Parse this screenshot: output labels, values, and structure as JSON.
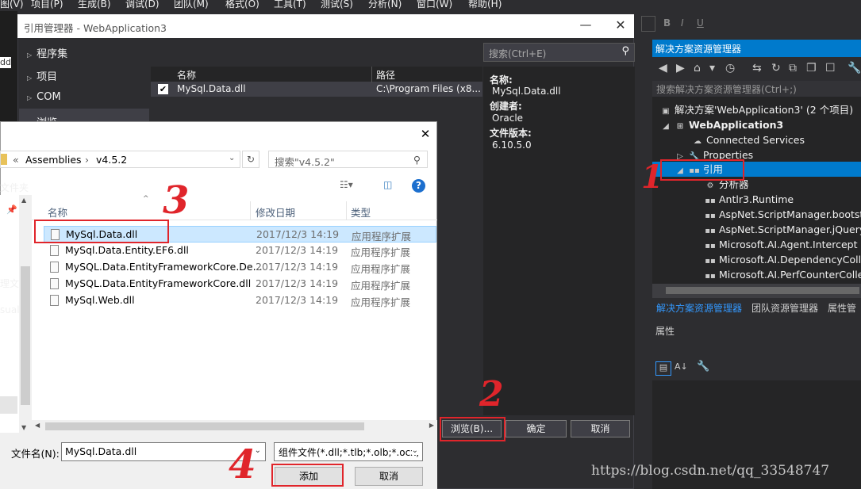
{
  "menu": [
    "图(V)",
    "项目(P)",
    "生成(B)",
    "调试(D)",
    "团队(M)",
    "格式(O)",
    "工具(T)",
    "测试(S)",
    "分析(N)",
    "窗口(W)",
    "帮助(H)"
  ],
  "left_edge_fragments": [
    "ddl",
    "理文",
    "sual"
  ],
  "reference_manager": {
    "title": "引用管理器 - WebApplication3",
    "nav": [
      "程序集",
      "项目",
      "COM",
      "浏览"
    ],
    "search_placeholder": "搜索(Ctrl+E)",
    "list_headers": {
      "name": "名称",
      "path": "路径"
    },
    "row": {
      "checked": true,
      "name": "MySql.Data.dll",
      "path": "C:\\Program Files (x8..."
    },
    "details": {
      "name_label": "名称:",
      "name_value": "MySql.Data.dll",
      "creator_label": "创建者:",
      "creator_value": "Oracle",
      "version_label": "文件版本:",
      "version_value": "6.10.5.0"
    },
    "buttons": {
      "browse": "浏览(B)...",
      "ok": "确定",
      "cancel": "取消"
    }
  },
  "file_dialog": {
    "breadcrumb": [
      "Assemblies",
      "v4.5.2"
    ],
    "search_placeholder": "搜索\"v4.5.2\"",
    "nav_fragment": "文件夹",
    "columns": {
      "name": "名称",
      "date": "修改日期",
      "type": "类型"
    },
    "files": [
      {
        "name": "MySql.Data.dll",
        "date": "2017/12/3 14:19",
        "type": "应用程序扩展"
      },
      {
        "name": "MySql.Data.Entity.EF6.dll",
        "date": "2017/12/3 14:19",
        "type": "应用程序扩展"
      },
      {
        "name": "MySQL.Data.EntityFrameworkCore.De...",
        "date": "2017/12/3 14:19",
        "type": "应用程序扩展"
      },
      {
        "name": "MySQL.Data.EntityFrameworkCore.dll",
        "date": "2017/12/3 14:19",
        "type": "应用程序扩展"
      },
      {
        "name": "MySql.Web.dll",
        "date": "2017/12/3 14:19",
        "type": "应用程序扩展"
      }
    ],
    "filename_label": "文件名(N):",
    "filename_value": "MySql.Data.dll",
    "filter_value": "组件文件(*.dll;*.tlb;*.olb;*.ocx;",
    "buttons": {
      "add": "添加",
      "cancel": "取消"
    }
  },
  "solution_explorer": {
    "title": "解决方案资源管理器",
    "search_placeholder": "搜索解决方案资源管理器(Ctrl+;)",
    "tree": {
      "solution": "解决方案'WebApplication3' (2 个项目)",
      "project": "WebApplication3",
      "connected": "Connected Services",
      "properties": "Properties",
      "references": "引用",
      "analyzers": "分析器",
      "refs": [
        "Antlr3.Runtime",
        "AspNet.ScriptManager.bootstr",
        "AspNet.ScriptManager.jQuery",
        "Microsoft.AI.Agent.Intercept",
        "Microsoft.AI.DependencyColle",
        "Microsoft.AI.PerfCounterColle"
      ]
    },
    "tabs": [
      "解决方案资源管理器",
      "团队资源管理器",
      "属性管"
    ],
    "properties_title": "属性"
  },
  "annotations": [
    "1",
    "2",
    "3",
    "4"
  ],
  "watermark": "https://blog.csdn.net/qq_33548747",
  "colors": {
    "accent": "#007acc",
    "annotation": "#e0252b",
    "selection": "#cce8ff"
  }
}
